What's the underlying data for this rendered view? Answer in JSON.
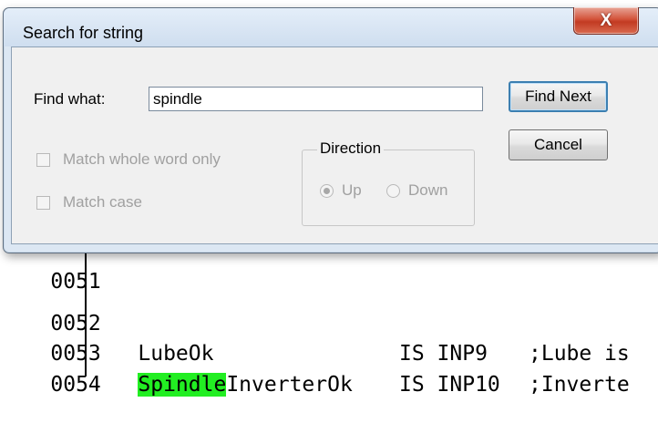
{
  "editor": {
    "lines": [
      {
        "num": "0051",
        "text": ""
      },
      {
        "num": "0052",
        "text": ""
      },
      {
        "num": "0053",
        "name": "LubeOk",
        "is": "IS INP9 ",
        "comment": ";Lube is"
      },
      {
        "num": "0054",
        "highlight": "Spindle",
        "name_rest": "InverterOk",
        "is": "IS INP10",
        "comment": ";Inverte"
      }
    ]
  },
  "dialog": {
    "title": "Search for string",
    "close_label": "X",
    "find_label": "Find what:",
    "find_value": "spindle",
    "find_next_label": "Find Next",
    "cancel_label": "Cancel",
    "match_whole_word_label": "Match whole word only",
    "match_case_label": "Match case",
    "direction_label": "Direction",
    "up_label": "Up",
    "down_label": "Down"
  }
}
